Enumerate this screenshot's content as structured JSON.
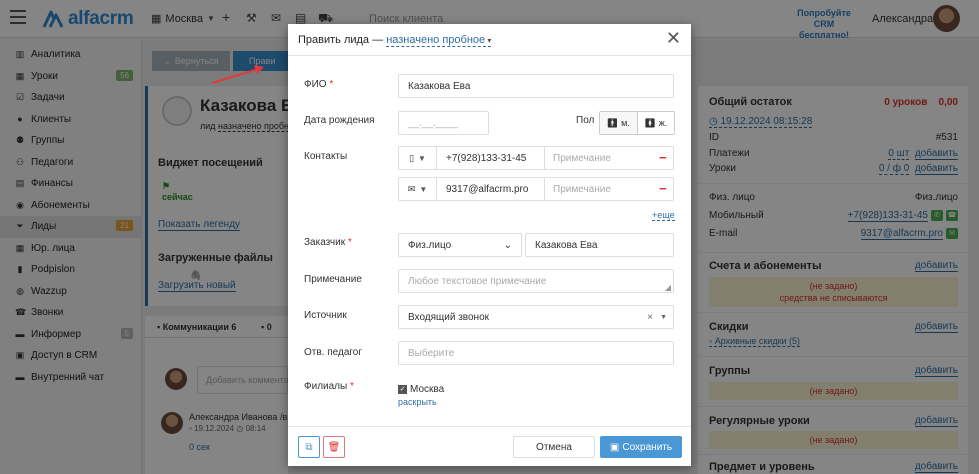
{
  "topbar": {
    "logo_text": "alfacrm",
    "branch": "Москва",
    "search_placeholder": "Поиск клиента",
    "promo_line1": "Попробуйте",
    "promo_line2": "CRM бесплатно!",
    "user_name": "Александра"
  },
  "sidebar": {
    "items": [
      {
        "label": "Аналитика",
        "icon": "chart-icon"
      },
      {
        "label": "Уроки",
        "icon": "calendar-icon",
        "badge": "56",
        "badge_color": "#7fb86e"
      },
      {
        "label": "Задачи",
        "icon": "tasks-icon"
      },
      {
        "label": "Клиенты",
        "icon": "user-icon"
      },
      {
        "label": "Группы",
        "icon": "users-icon"
      },
      {
        "label": "Педагоги",
        "icon": "teacher-icon"
      },
      {
        "label": "Финансы",
        "icon": "money-icon"
      },
      {
        "label": "Абонементы",
        "icon": "ticket-icon"
      },
      {
        "label": "Лиды",
        "icon": "funnel-icon",
        "badge": "21",
        "badge_color": "#e8a33a"
      },
      {
        "label": "Юр. лица",
        "icon": "building-icon"
      },
      {
        "label": "Podpislon",
        "icon": "document-icon"
      },
      {
        "label": "Wazzup",
        "icon": "chat-icon"
      },
      {
        "label": "Звонки",
        "icon": "phone-icon"
      },
      {
        "label": "Информер",
        "icon": "bell-icon",
        "badge": "5",
        "badge_color": "#bbbbbb"
      },
      {
        "label": "Доступ в CRM",
        "icon": "lock-icon"
      },
      {
        "label": "Внутренний чат",
        "icon": "message-icon"
      }
    ],
    "active_index": 8
  },
  "background": {
    "back_label": "← Вернуться",
    "edit_label": "Прави",
    "lead_name": "Казакова Е",
    "lead_tag_prefix": "лид",
    "lead_tag_status": "назначено пробное",
    "widget_visits": "Виджет посещений",
    "now_label": "сейчас",
    "show_legend": "Показать легенду",
    "uploaded_files": "Загруженные файлы",
    "upload_new": "Загрузить новый",
    "comm_tab": "Коммуникации 6",
    "comm_tab2": "0",
    "comment_placeholder": "Добавить коммента",
    "comment_author": "Александра Иванова",
    "comment_meta": "/в",
    "comment_date": "19.12.2024",
    "comment_time": "08:14",
    "comment_duration": "0 сек"
  },
  "right_panel": {
    "balance_title": "Общий остаток",
    "balance_value": "0 уроков",
    "balance_amount": "0,00",
    "date_link": "19.12.2024 08:15:28",
    "id_label": "ID",
    "id_value": "#531",
    "payments_label": "Платежи",
    "payments_value": "0 шт",
    "lessons_label": "Уроки",
    "lessons_value": "0 / ф 0",
    "add_label": "добавить",
    "person_label": "Физ. лицо",
    "person_value": "Физ.лицо",
    "mobile_label": "Мобильный",
    "mobile_value": "+7(928)133-31-45",
    "email_label": "E-mail",
    "email_value": "9317@alfacrm.pro",
    "subs_title": "Счета и абонементы",
    "subs_note1": "(не задано)",
    "subs_note2": "средства не списываются",
    "discounts_title": "Скидки",
    "archived_discounts": "Архивные скидки (5)",
    "groups_title": "Группы",
    "not_set": "(не задано)",
    "regular_title": "Регулярные уроки",
    "subject_title": "Предмет и уровень"
  },
  "modal": {
    "title": "Править лида —",
    "status": "назначено пробное",
    "fio_label": "ФИО",
    "fio_value": "Казакова Ева",
    "birthdate_label": "Дата рождения",
    "birthdate_placeholder": "__.__.____",
    "gender_label": "Пол",
    "gender_m": "м.",
    "gender_f": "ж.",
    "contacts_label": "Контакты",
    "phone_value": "+7(928)133-31-45",
    "email_value": "9317@alfacrm.pro",
    "note_placeholder": "Примечание",
    "more_link": "+еще",
    "customer_label": "Заказчик",
    "customer_type": "Физ.лицо",
    "customer_name": "Казакова Ева",
    "note_label": "Примечание",
    "note_textarea_placeholder": "Любое текстовое примечание",
    "source_label": "Источник",
    "source_value": "Входящий звонок",
    "teacher_label": "Отв. педагог",
    "teacher_placeholder": "Выберите",
    "branches_label": "Филиалы",
    "branch_value": "Москва",
    "expand_link": "раскрыть",
    "cancel_label": "Отмена",
    "save_label": "Сохранить"
  },
  "colors": {
    "brand": "#2f8ad6",
    "primary_button": "#4a97d6",
    "required": "#d9312b",
    "link": "#2f6ea3"
  }
}
